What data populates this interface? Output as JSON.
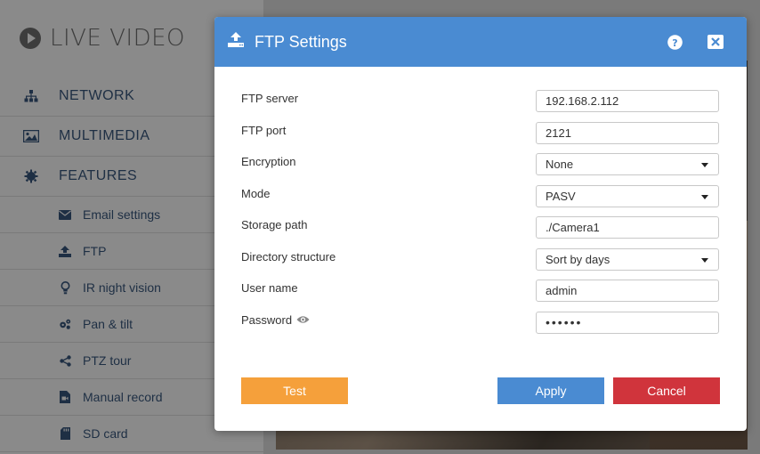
{
  "app": {
    "title": "LIVE VIDEO"
  },
  "sidebar": {
    "items": [
      {
        "label": "NETWORK",
        "icon": "network-icon"
      },
      {
        "label": "MULTIMEDIA",
        "icon": "image-icon"
      },
      {
        "label": "FEATURES",
        "icon": "gear-icon"
      }
    ],
    "subitems": [
      {
        "label": "Email settings",
        "icon": "envelope-icon"
      },
      {
        "label": "FTP",
        "icon": "upload-icon"
      },
      {
        "label": "IR night vision",
        "icon": "lightbulb-icon"
      },
      {
        "label": "Pan & tilt",
        "icon": "cogs-icon"
      },
      {
        "label": "PTZ tour",
        "icon": "share-icon"
      },
      {
        "label": "Manual record",
        "icon": "file-video-icon"
      },
      {
        "label": "SD card",
        "icon": "sd-card-icon"
      }
    ]
  },
  "dialog": {
    "title": "FTP Settings",
    "icons": {
      "title": "upload-icon",
      "help": "help-icon",
      "close": "close-icon"
    },
    "fields": {
      "ftp_server": {
        "label": "FTP server",
        "value": "192.168.2.112"
      },
      "ftp_port": {
        "label": "FTP port",
        "value": "2121"
      },
      "encryption": {
        "label": "Encryption",
        "value": "None"
      },
      "mode": {
        "label": "Mode",
        "value": "PASV"
      },
      "storage_path": {
        "label": "Storage path",
        "value": "./Camera1"
      },
      "directory_structure": {
        "label": "Directory structure",
        "value": "Sort by days"
      },
      "user_name": {
        "label": "User name",
        "value": "admin"
      },
      "password": {
        "label": "Password",
        "value": "••••••",
        "icon": "eye-icon"
      }
    },
    "buttons": {
      "test": "Test",
      "apply": "Apply",
      "cancel": "Cancel"
    }
  },
  "colors": {
    "header": "#4a8bd2",
    "test": "#f5a03b",
    "apply": "#4a8bd2",
    "cancel": "#d0343c"
  }
}
